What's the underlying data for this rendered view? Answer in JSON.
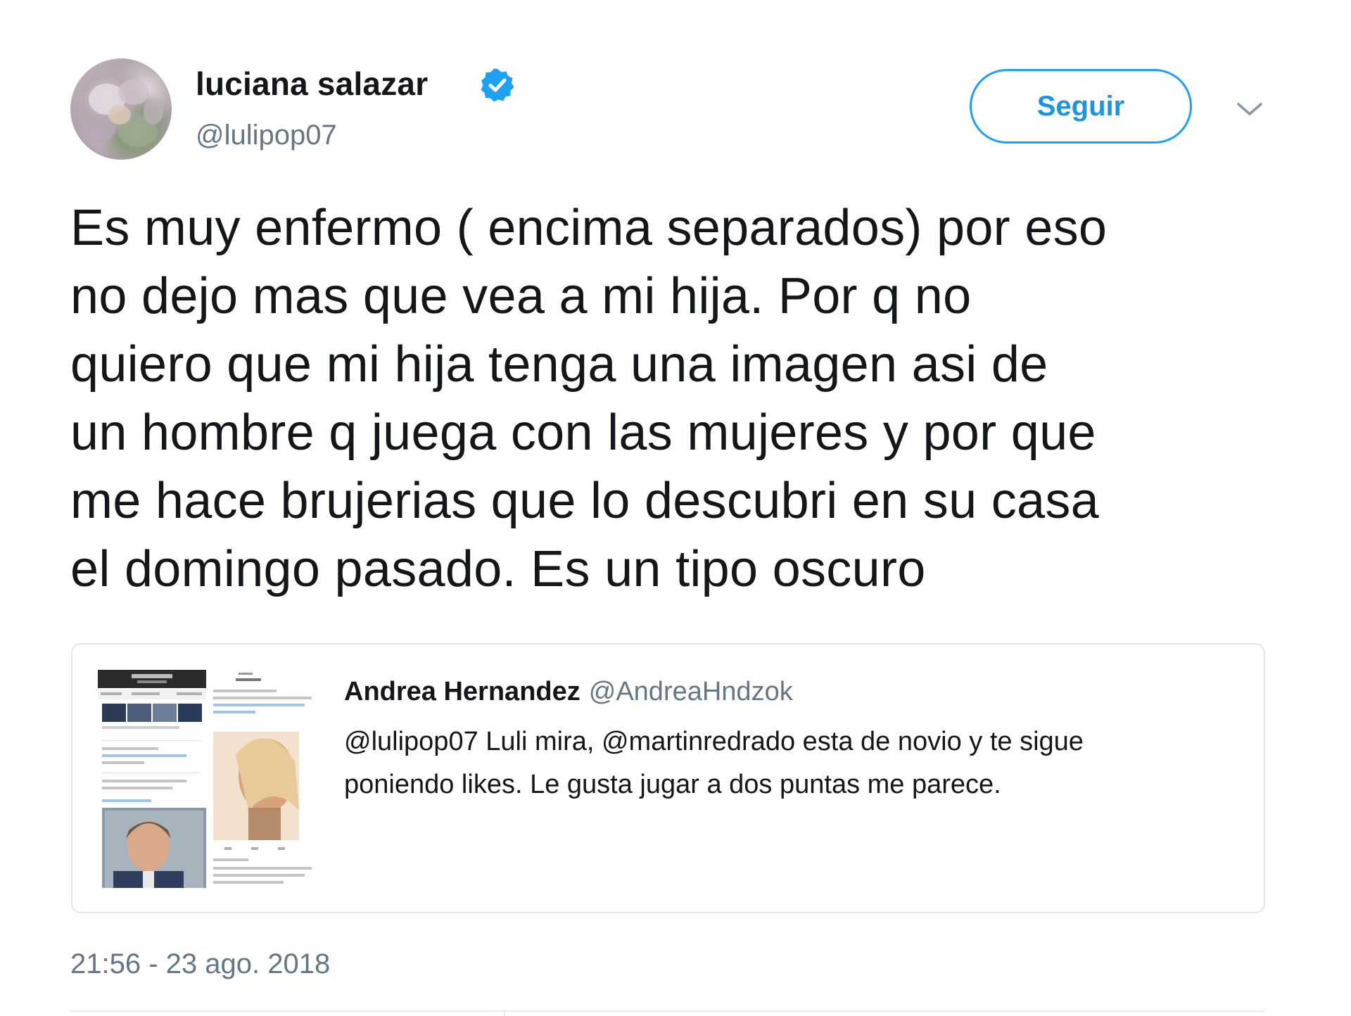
{
  "author": {
    "name": "luciana salazar",
    "handle": "@lulipop07",
    "verified": true
  },
  "header": {
    "follow_label": "Seguir",
    "menu_icon": "chevron-down-icon"
  },
  "tweet": {
    "lines": [
      "Es muy enfermo ( encima separados) por eso",
      "no dejo mas que vea a mi hija. Por q no",
      "quiero que mi hija tenga una imagen asi de",
      "un hombre q juega con las mujeres y por que",
      "me hace brujerias que lo descubri en su casa",
      "el domingo pasado. Es un tipo oscuro"
    ]
  },
  "quoted_tweet": {
    "author_name": "Andrea Hernandez",
    "author_handle": "@AndreaHndzok",
    "lines": [
      "@lulipop07 Luli mira, @martinredrado esta de novio y te sigue",
      "poniendo likes. Le gusta jugar a dos puntas me parece."
    ]
  },
  "footer": {
    "timestamp": "21:56 - 23 ago. 2018"
  },
  "colors": {
    "accent": "#1da1f2",
    "accent_text": "#1b95e0",
    "text_primary": "#14171a",
    "text_secondary": "#657786",
    "border": "#e1e8ed"
  }
}
